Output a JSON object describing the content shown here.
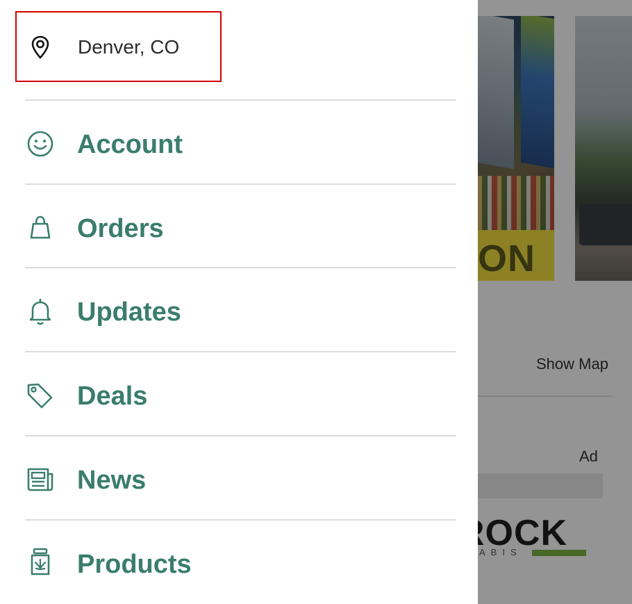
{
  "location": {
    "label": "Denver, CO",
    "icon": "location-pin-icon"
  },
  "menu": {
    "items": [
      {
        "label": "Account",
        "icon": "smiley-face-icon"
      },
      {
        "label": "Orders",
        "icon": "shopping-bag-icon"
      },
      {
        "label": "Updates",
        "icon": "bell-icon"
      },
      {
        "label": "Deals",
        "icon": "tag-icon"
      },
      {
        "label": "News",
        "icon": "newspaper-icon"
      },
      {
        "label": "Products",
        "icon": "jar-icon"
      }
    ]
  },
  "background": {
    "show_map_label": "Show Map",
    "ad_label": "Ad",
    "photo_banner_text": "ON",
    "ad_logo_text": "ROCK",
    "ad_logo_subtext": "ABIS"
  },
  "colors": {
    "menu_text": "#3a7d6c",
    "highlight_border": "#d40000",
    "overlay": "rgba(0,0,0,0.42)"
  }
}
